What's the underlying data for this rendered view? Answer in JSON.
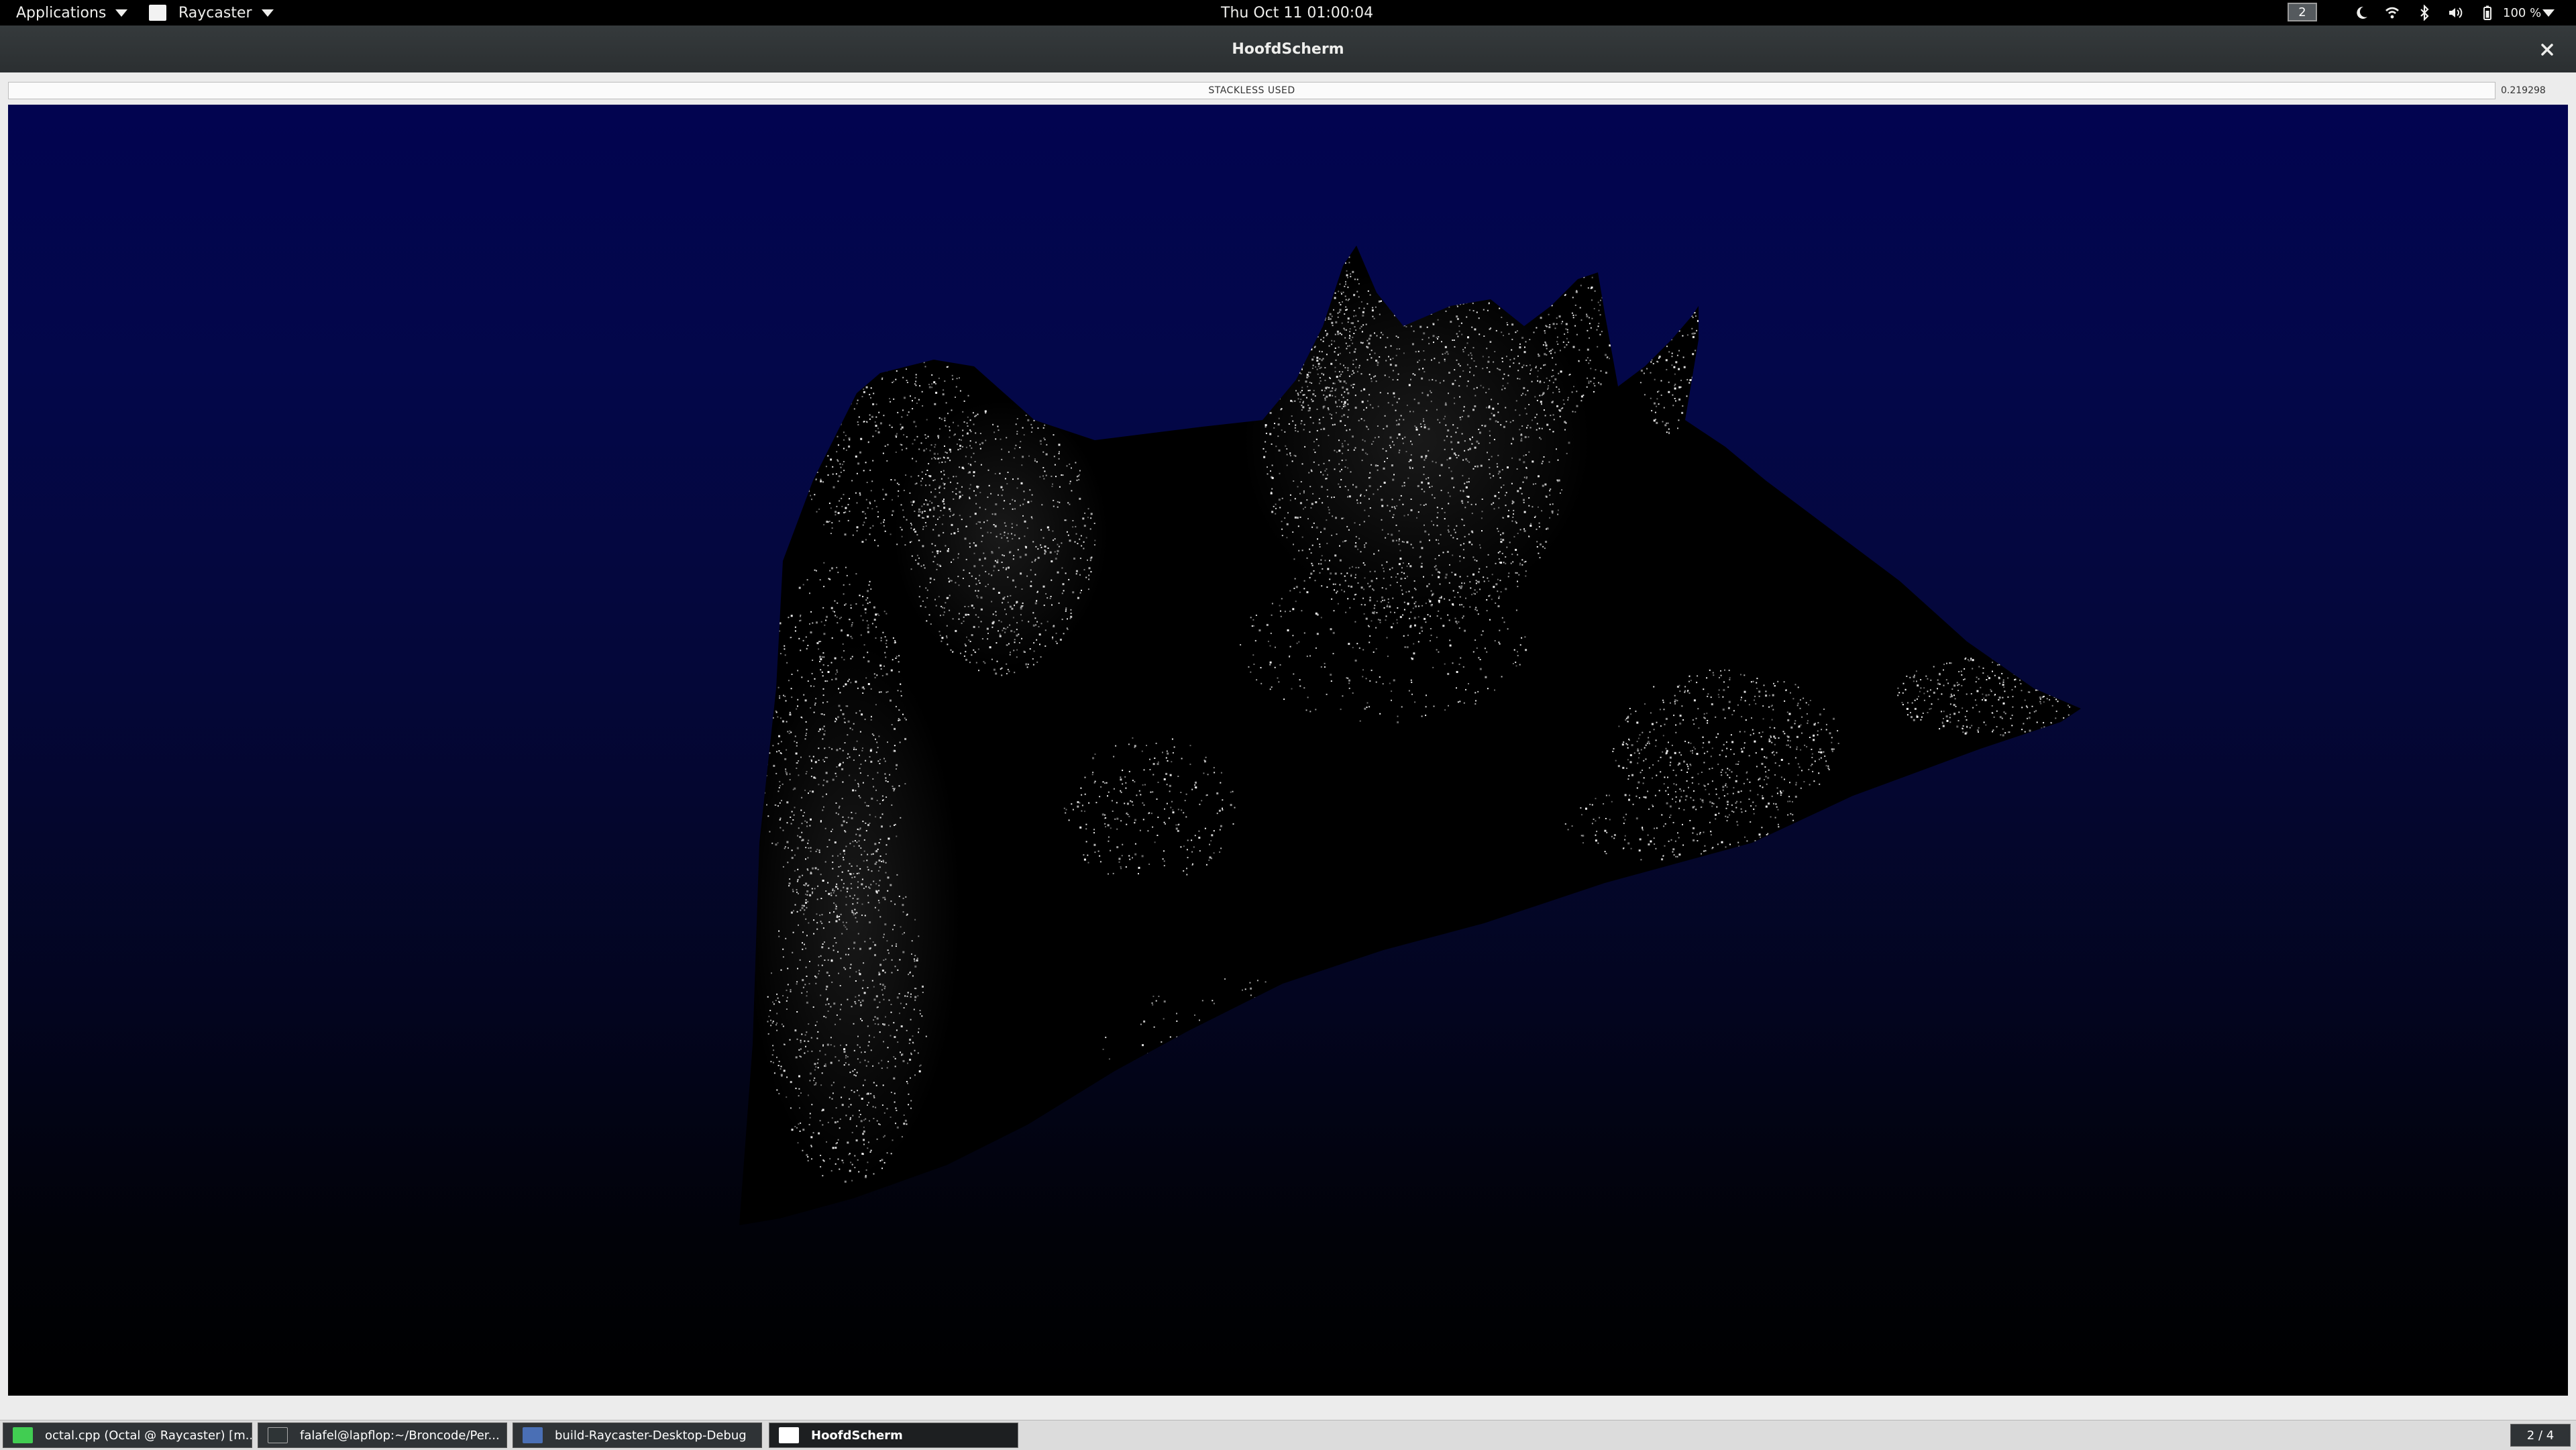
{
  "top_panel": {
    "applications_label": "Applications",
    "app_menu_label": "Raycaster",
    "clock": "Thu Oct 11  01:00:04",
    "workspace_number": "2",
    "battery_percent": "100 %",
    "tray_icons": [
      "night-light-icon",
      "wifi-icon",
      "bluetooth-icon",
      "volume-icon",
      "battery-icon",
      "chevron-down-icon"
    ]
  },
  "window": {
    "title": "HoofdScherm",
    "close_icon": "close-icon"
  },
  "status": {
    "message": "STACKLESS USED",
    "timing": "0.219298"
  },
  "render": {
    "description_colors": {
      "sky_top": "#020450",
      "sky_bottom": "#000000",
      "terrain": "#000000",
      "points": "#ffffff"
    }
  },
  "taskbar": {
    "tasks": [
      {
        "label": "octal.cpp (Octal @ Raycaster) [m...",
        "icon": "qt-creator-icon",
        "icon_color": "#41cd52"
      },
      {
        "label": "falafel@lapflop:~/Broncode/Per...",
        "icon": "terminal-icon",
        "icon_color": "#2e3436"
      },
      {
        "label": "build-Raycaster-Desktop-Debug",
        "icon": "folder-icon",
        "icon_color": "#4a6fb5"
      },
      {
        "label": "HoofdScherm",
        "icon": "window-icon",
        "icon_color": "#ffffff"
      }
    ],
    "workspace_indicator": "2 / 4"
  }
}
